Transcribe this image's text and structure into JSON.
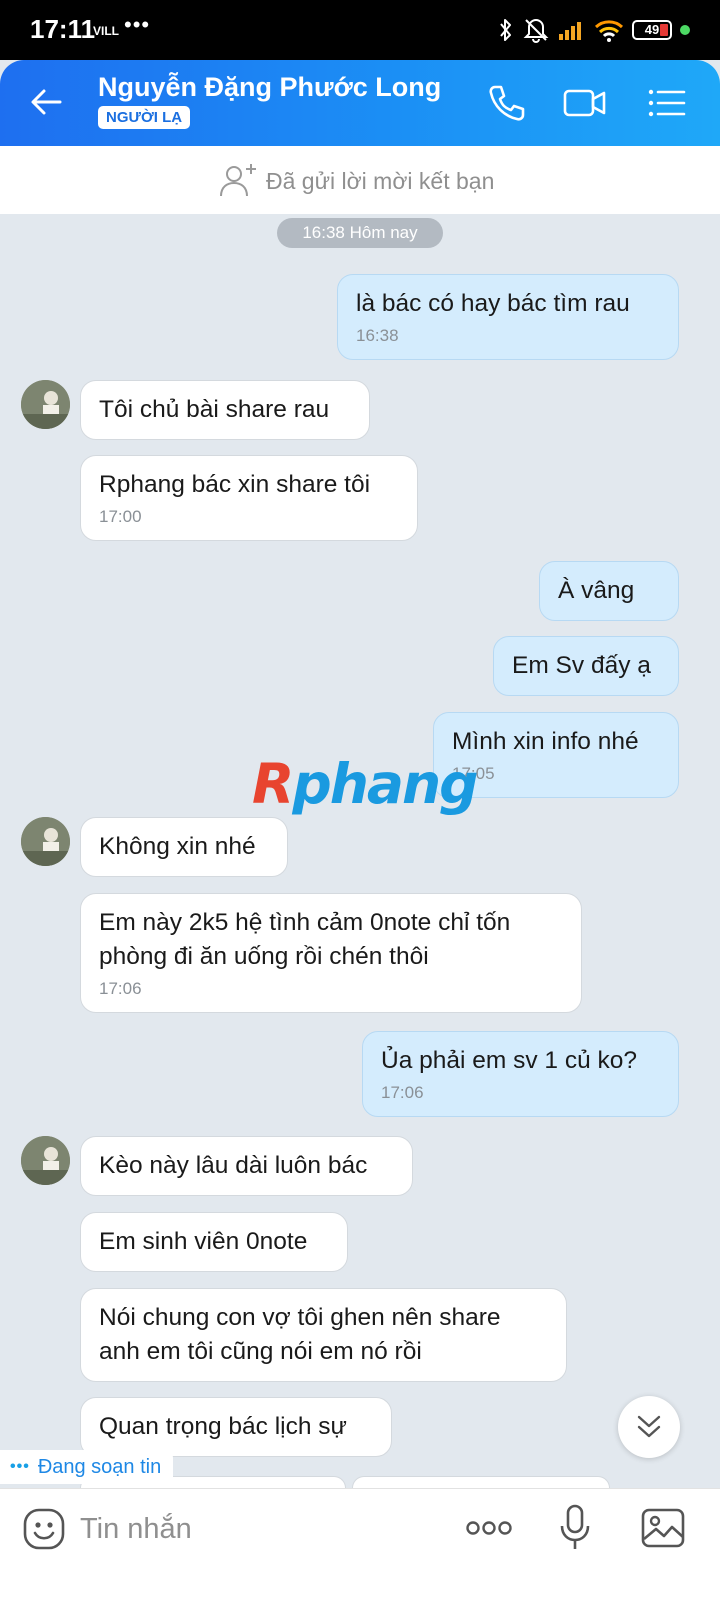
{
  "status_bar": {
    "time": "17:11",
    "volte": "VILL",
    "more": "•••",
    "battery": "49"
  },
  "header": {
    "contact_name": "Nguyễn Đặng Phước Long",
    "badge": "NGƯỜI LẠ"
  },
  "friend_request": {
    "text": "Đã gửi lời mời kết bạn"
  },
  "date_separator": "16:38 Hôm nay",
  "messages": [
    {
      "side": "out",
      "text": "là bác có hay bác tìm rau",
      "time": "16:38"
    },
    {
      "side": "in",
      "text": "Tôi chủ bài share rau",
      "time": ""
    },
    {
      "side": "in",
      "text": "Rphang bác xin share tôi",
      "time": "17:00"
    },
    {
      "side": "out",
      "text": "À vâng",
      "time": ""
    },
    {
      "side": "out",
      "text": "Em Sv đấy ạ",
      "time": ""
    },
    {
      "side": "out",
      "text": "Mình xin info nhé",
      "time": "17:05"
    },
    {
      "side": "in",
      "text": "Không xin nhé",
      "time": ""
    },
    {
      "side": "in",
      "text": "Em này 2k5 hệ tình cảm 0note chỉ tốn\nphòng đi ăn uống rồi chén thôi",
      "time": "17:06"
    },
    {
      "side": "out",
      "text": "Ủa phải em sv 1 củ ko?",
      "time": "17:06"
    },
    {
      "side": "in",
      "text": "Kèo này lâu dài luôn bác",
      "time": ""
    },
    {
      "side": "in",
      "text": "Em sinh viên 0note",
      "time": ""
    },
    {
      "side": "in",
      "text": "Nói chung con vợ tôi ghen nên share\nanh em tôi cũng nói em nó rồi",
      "time": ""
    },
    {
      "side": "in",
      "text": "Quan trọng bác lịch sự",
      "time": ""
    }
  ],
  "watermark": {
    "first": "R",
    "rest": "phang"
  },
  "typing_indicator": {
    "dots": "•••",
    "text": "Đang soạn tin"
  },
  "input": {
    "placeholder": "Tin nhắn"
  },
  "icons": {
    "back": "arrow-left-icon",
    "call": "phone-icon",
    "video": "video-camera-icon",
    "menu": "list-menu-icon",
    "add_friend": "add-person-icon",
    "scroll_down": "double-chevron-down-icon",
    "emoji": "emoji-icon",
    "more": "three-dots-icon",
    "mic": "microphone-icon",
    "image": "image-icon"
  },
  "colors": {
    "header_start": "#1e6ff0",
    "header_end": "#1fa8f8",
    "outgoing_bubble": "#d4ecfd",
    "incoming_bubble": "#ffffff",
    "chat_background": "#e2e8ee"
  }
}
